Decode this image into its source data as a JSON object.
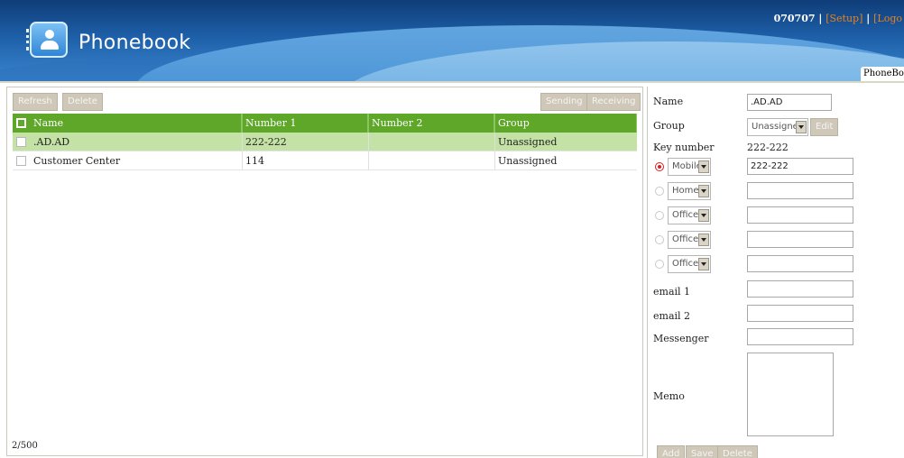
{
  "header": {
    "app_title": "Phonebook",
    "user_id": "070707",
    "setup_link": "[Setup]",
    "logout_link": "[Logo",
    "separator": "|",
    "tab_label": "PhoneBoo"
  },
  "toolbar": {
    "refresh": "Refresh",
    "delete": "Delete",
    "sending": "Sending",
    "receiving": "Receiving"
  },
  "table": {
    "columns": [
      "Name",
      "Number 1",
      "Number 2",
      "Group"
    ],
    "rows": [
      {
        "name": ".AD.AD",
        "number1": "222-222",
        "number2": "",
        "group": "Unassigned",
        "selected": true
      },
      {
        "name": "Customer Center",
        "number1": "114",
        "number2": "",
        "group": "Unassigned",
        "selected": false
      }
    ]
  },
  "footer": {
    "count": "2/500"
  },
  "detail": {
    "name_label": "Name",
    "name_value": ".AD.AD",
    "group_label": "Group",
    "group_value": "Unassigned",
    "edit_button": "Edit",
    "key_number_label": "Key number",
    "key_number_value": "222-222",
    "phones": [
      {
        "type": "Mobile",
        "value": "222-222",
        "checked": true
      },
      {
        "type": "Home",
        "value": "",
        "checked": false
      },
      {
        "type": "Office",
        "value": "",
        "checked": false
      },
      {
        "type": "Office",
        "value": "",
        "checked": false
      },
      {
        "type": "Office",
        "value": "",
        "checked": false
      }
    ],
    "email1_label": "email 1",
    "email1_value": "",
    "email2_label": "email 2",
    "email2_value": "",
    "messenger_label": "Messenger",
    "messenger_value": "",
    "memo_label": "Memo",
    "memo_value": "",
    "add_button": "Add",
    "save_button": "Save",
    "delete_button": "Delete"
  },
  "colors": {
    "header_bg": "#1d5fa8",
    "table_header": "#5ea728",
    "selected_row": "#c5e2a6",
    "button_bg": "#cfc8b8",
    "link_orange": "#e8821e",
    "radio_selected": "#d81e1e"
  }
}
